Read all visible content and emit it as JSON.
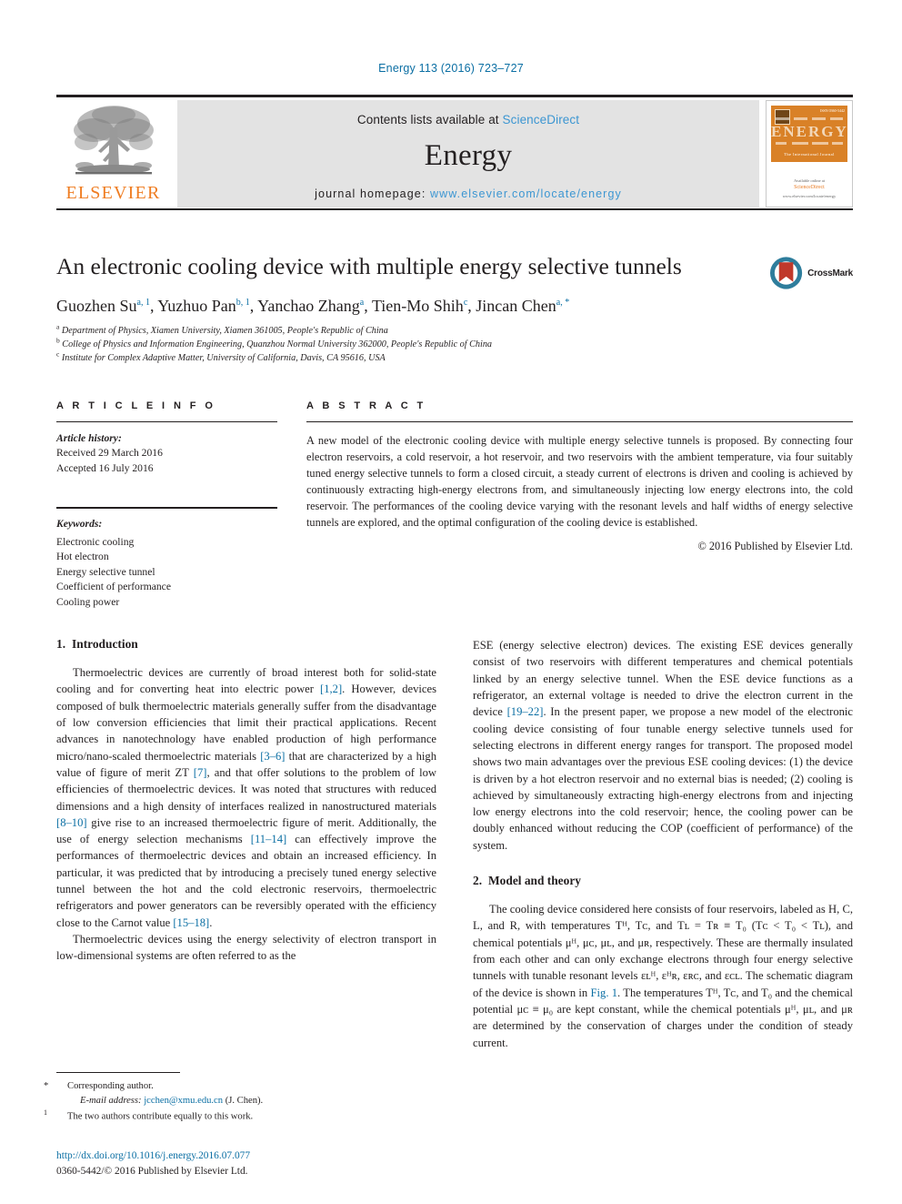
{
  "running_head": "Energy 113 (2016) 723–727",
  "masthead": {
    "publisher_name": "ELSEVIER",
    "contents_prefix": "Contents lists available at ",
    "contents_link": "ScienceDirect",
    "journal_name": "Energy",
    "homepage_label": "journal homepage: ",
    "homepage_url": "www.elsevier.com/locate/energy",
    "cover": {
      "title": "ENERGY",
      "subtitle": "The International Journal",
      "issue_label": "ISSN 0360-5442",
      "footer_line1": "Available online at",
      "footer_line2": "ScienceDirect",
      "footer_line3": "www.elsevier.com/locate/energy"
    }
  },
  "article": {
    "title": "An electronic cooling device with multiple energy selective tunnels",
    "crossmark_label": "CrossMark",
    "authors": [
      {
        "name": "Guozhen Su",
        "marks": "a, 1",
        "sep": ", "
      },
      {
        "name": "Yuzhuo Pan",
        "marks": "b, 1",
        "sep": ", "
      },
      {
        "name": "Yanchao Zhang",
        "marks": "a",
        "sep": ", "
      },
      {
        "name": "Tien-Mo Shih",
        "marks": "c",
        "sep": ", "
      },
      {
        "name": "Jincan Chen",
        "marks": "a, *",
        "sep": ""
      }
    ],
    "affiliations": [
      {
        "mark": "a",
        "text": "Department of Physics, Xiamen University, Xiamen 361005, People's Republic of China"
      },
      {
        "mark": "b",
        "text": "College of Physics and Information Engineering, Quanzhou Normal University 362000, People's Republic of China"
      },
      {
        "mark": "c",
        "text": "Institute for Complex Adaptive Matter, University of California, Davis, CA 95616, USA"
      }
    ]
  },
  "article_info": {
    "heading": "A R T I C L E    I N F O",
    "history_label": "Article history:",
    "received": "Received 29 March 2016",
    "accepted": "Accepted 16 July 2016",
    "keywords_label": "Keywords:",
    "keywords": [
      "Electronic cooling",
      "Hot electron",
      "Energy selective tunnel",
      "Coefficient of performance",
      "Cooling power"
    ]
  },
  "abstract": {
    "heading": "A B S T R A C T",
    "text": "A new model of the electronic cooling device with multiple energy selective tunnels is proposed. By connecting four electron reservoirs, a cold reservoir, a hot reservoir, and two reservoirs with the ambient temperature, via four suitably tuned energy selective tunnels to form a closed circuit, a steady current of electrons is driven and cooling is achieved by continuously extracting high-energy electrons from, and simultaneously injecting low energy electrons into, the cold reservoir. The performances of the cooling device varying with the resonant levels and half widths of energy selective tunnels are explored, and the optimal configuration of the cooling device is established.",
    "copyright": "© 2016 Published by Elsevier Ltd."
  },
  "sections": {
    "intro_number": "1.",
    "intro_title": "Introduction",
    "model_number": "2.",
    "model_title": "Model and theory"
  },
  "body": {
    "left_p1_a": "Thermoelectric devices are currently of broad interest both for solid-state cooling and for converting heat into electric power ",
    "left_p1_r1": "[1,2]",
    "left_p1_b": ". However, devices composed of bulk thermoelectric materials generally suffer from the disadvantage of low conversion efficiencies that limit their practical applications. Recent advances in nanotechnology have enabled production of high performance micro/nano-scaled thermoelectric materials ",
    "left_p1_r2": "[3–6]",
    "left_p1_c": " that are characterized by a high value of figure of merit ZT ",
    "left_p1_r3": "[7]",
    "left_p1_d": ", and that offer solutions to the problem of low efficiencies of thermoelectric devices. It was noted that structures with reduced dimensions and a high density of interfaces realized in nanostructured materials ",
    "left_p1_r4": "[8–10]",
    "left_p1_e": " give rise to an increased thermoelectric figure of merit. Additionally, the use of energy selection mechanisms ",
    "left_p1_r5": "[11–14]",
    "left_p1_f": " can effectively improve the performances of thermoelectric devices and obtain an increased efficiency. In particular, it was predicted that by introducing a precisely tuned energy selective tunnel between the hot and the cold electronic reservoirs, thermoelectric refrigerators and power generators can be reversibly operated with the efficiency close to the Carnot value ",
    "left_p1_r6": "[15–18]",
    "left_p1_g": ".",
    "left_p2": "Thermoelectric devices using the energy selectivity of electron transport in low-dimensional systems are often referred to as the",
    "right_p1_a": "ESE (energy selective electron) devices. The existing ESE devices generally consist of two reservoirs with different temperatures and chemical potentials linked by an energy selective tunnel. When the ESE device functions as a refrigerator, an external voltage is needed to drive the electron current in the device ",
    "right_p1_r1": "[19–22]",
    "right_p1_b": ". In the present paper, we propose a new model of the electronic cooling device consisting of four tunable energy selective tunnels used for selecting electrons in different energy ranges for transport. The proposed model shows two main advantages over the previous ESE cooling devices: (1) the device is driven by a hot electron reservoir and no external bias is needed; (2) cooling is achieved by simultaneously extracting high-energy electrons from and injecting low energy electrons into the cold reservoir; hence, the cooling power can be doubly enhanced without reducing the COP (coefficient of performance) of the system.",
    "right_p2_a": "The cooling device considered here consists of four reservoirs, labeled as H, C, L, and R, with temperatures ",
    "right_p2_b": " (",
    "right_p2_c": "), and chemical potentials ",
    "right_p2_d": ", respectively. These are thermally insulated from each other and can only exchange electrons through four energy selective tunnels with tunable resonant levels ",
    "right_p2_e": ". The schematic diagram of the device is shown in ",
    "right_p2_fig": "Fig. 1",
    "right_p2_f": ". The temperatures ",
    "right_p2_g": " and the chemical potential ",
    "right_p2_h": " are kept constant, while the chemical potentials ",
    "right_p2_i": " are determined by the conservation of charges under the condition of steady current."
  },
  "math": {
    "temps1": "Tᴴ, Tᴄ, and Tʟ = Tʀ ≡ T₀",
    "ineq": "Tᴄ < T₀ < Tʟ",
    "mus": "μᴴ, μᴄ, μʟ, and μʀ",
    "levels": "εʟᴴ, εᴴʀ, εʀᴄ, and εᴄʟ",
    "temps2": "Tᴴ, Tᴄ, and T₀",
    "muc": "μᴄ ≡ μ₀",
    "mus2": "μᴴ, μʟ, and μʀ"
  },
  "footnotes": {
    "corresponding_mark": "*",
    "corresponding_text": "Corresponding author.",
    "email_label": "E-mail address:",
    "email": "jcchen@xmu.edu.cn",
    "email_suffix": "(J. Chen).",
    "equal_mark": "1",
    "equal_text": "The two authors contribute equally to this work."
  },
  "footer": {
    "doi": "http://dx.doi.org/10.1016/j.energy.2016.07.077",
    "issn_line": "0360-5442/© 2016 Published by Elsevier Ltd."
  }
}
